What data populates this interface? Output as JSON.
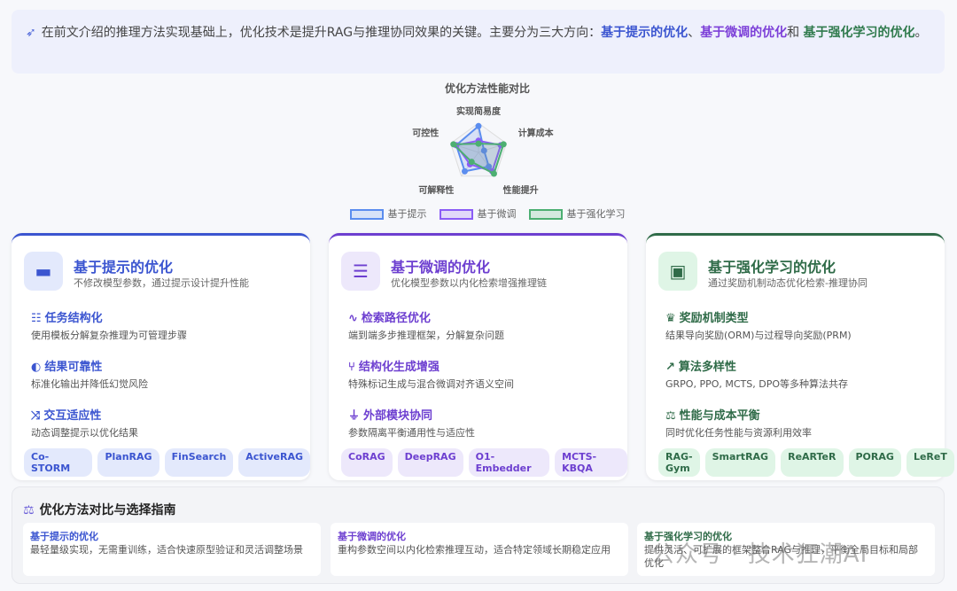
{
  "intro": {
    "text": "在前文介绍的推理方法实现基础上，优化技术是提升RAG与推理协同效果的关键。主要分为三大方向：",
    "d1": "基于提示的优化",
    "sep1": "、",
    "d2": "基于微调的优化",
    "sep2": "和 ",
    "d3": "基于强化学习的优化",
    "end": "。"
  },
  "chart_data": {
    "type": "radar",
    "title": "优化方法性能对比",
    "axes": [
      "实现简易度",
      "计算成本",
      "性能提升",
      "可解释性",
      "可控性"
    ],
    "range": [
      0,
      10
    ],
    "series": [
      {
        "name": "基于提示",
        "values": [
          9,
          2,
          6,
          8,
          8
        ],
        "color": "#5b8def"
      },
      {
        "name": "基于微调",
        "values": [
          4,
          8,
          8,
          5,
          8
        ],
        "color": "#8b5cf6"
      },
      {
        "name": "基于强化学习",
        "values": [
          3,
          9,
          9,
          4,
          9
        ],
        "color": "#4caf72"
      }
    ]
  },
  "cards": [
    {
      "title": "基于提示的优化",
      "subtitle": "不修改模型参数，通过提示设计提升性能",
      "icon": "chat-icon",
      "color": "#3b55d0",
      "bg": "#e3e9fc",
      "features": [
        {
          "icon": "list-check-icon",
          "t": "任务结构化",
          "d": "使用模板分解复杂推理为可管理步骤"
        },
        {
          "icon": "shield-icon",
          "t": "结果可靠性",
          "d": "标准化输出并降低幻觉风险"
        },
        {
          "icon": "shuffle-icon",
          "t": "交互适应性",
          "d": "动态调整提示以优化结果"
        }
      ],
      "tags": [
        "Co-STORM",
        "PlanRAG",
        "FinSearch",
        "ActiveRAG"
      ]
    },
    {
      "title": "基于微调的优化",
      "subtitle": "优化模型参数以内化检索增强推理链",
      "icon": "sliders-icon",
      "color": "#6d3fd0",
      "bg": "#ede8fb",
      "features": [
        {
          "icon": "route-icon",
          "t": "检索路径优化",
          "d": "端到端多步推理框架，分解复杂问题"
        },
        {
          "icon": "branch-icon",
          "t": "结构化生成增强",
          "d": "特殊标记生成与混合微调对齐语义空间"
        },
        {
          "icon": "plug-icon",
          "t": "外部模块协同",
          "d": "参数隔离平衡通用性与适应性"
        }
      ],
      "tags": [
        "CoRAG",
        "DeepRAG",
        "O1-Embedder",
        "MCTS-KBQA"
      ]
    },
    {
      "title": "基于强化学习的优化",
      "subtitle": "通过奖励机制动态优化检索-推理协同",
      "icon": "robot-icon",
      "color": "#2f6b48",
      "bg": "#dff5e6",
      "features": [
        {
          "icon": "trophy-icon",
          "t": "奖励机制类型",
          "d": "结果导向奖励(ORM)与过程导向奖励(PRM)"
        },
        {
          "icon": "chart-line-icon",
          "t": "算法多样性",
          "d": "GRPO, PPO, MCTS, DPO等多种算法共存"
        },
        {
          "icon": "balance-icon",
          "t": "性能与成本平衡",
          "d": "同时优化任务性能与资源利用效率"
        }
      ],
      "tags": [
        "RAG-Gym",
        "SmartRAG",
        "ReARTeR",
        "PORAG",
        "LeReT"
      ]
    }
  ],
  "guide": {
    "title": "优化方法对比与选择指南",
    "items": [
      {
        "h": "基于提示的优化",
        "d": "最轻量级实现，无需重训练，适合快速原型验证和灵活调整场景"
      },
      {
        "h": "基于微调的优化",
        "d": "重构参数空间以内化检索推理互动，适合特定领域长期稳定应用"
      },
      {
        "h": "基于强化学习的优化",
        "d": "提供灵活、可扩展的框架整合RAG与推理，平衡全局目标和局部优化"
      }
    ]
  },
  "watermark": "公众号 · 技术狂潮AI"
}
